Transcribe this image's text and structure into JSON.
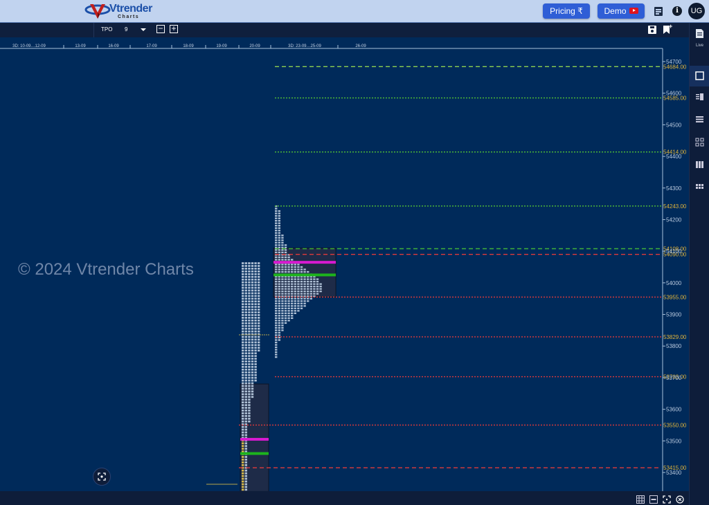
{
  "header": {
    "logo_brand": "Vtrender",
    "logo_sub": "Charts",
    "pricing_label": "Pricing ₹",
    "demo_label": "Demo",
    "avatar_initials": "UG",
    "icons": [
      "notes-icon",
      "info-icon"
    ]
  },
  "toolbar": {
    "tpo_label": "TPO",
    "tpo_value": "9",
    "minus_label": "−",
    "plus_label": "+",
    "icons": [
      "save-icon",
      "bookmark-add-icon"
    ]
  },
  "right_sidebar": {
    "live_label": "Live",
    "items": [
      "single-layout-icon",
      "split-layout-icon",
      "rows-layout-icon",
      "grid-2x2-icon",
      "columns-layout-icon",
      "grid-3x3-icon"
    ]
  },
  "bottom_bar": {
    "icons": [
      "grid-toggle-icon",
      "letters-toggle-icon",
      "fit-screen-icon",
      "close-circle-icon"
    ]
  },
  "watermark": "© 2024 Vtrender Charts",
  "chart_data": {
    "type": "tpo-market-profile",
    "x_labels": [
      "3D: 10-09…12-09",
      "13-09",
      "16-09",
      "17-09",
      "18-09",
      "19-09",
      "20-09",
      "3D: 23-09…25-09",
      "26-09"
    ],
    "y_ticks": [
      53400,
      53500,
      53600,
      53700,
      53800,
      53900,
      54000,
      54100,
      54200,
      54300,
      54400,
      54500,
      54600,
      54700
    ],
    "ylim": [
      53340,
      54730
    ],
    "levels": [
      {
        "price": 54684.0,
        "label": "54684.00",
        "color": "#8fd14f",
        "style": "dashed"
      },
      {
        "price": 54585.0,
        "label": "54585.00",
        "color": "#52c234",
        "style": "dotted"
      },
      {
        "price": 54414.0,
        "label": "54414.00",
        "color": "#52c234",
        "style": "dotted"
      },
      {
        "price": 54243.0,
        "label": "54243.00",
        "color": "#52c234",
        "style": "dotted"
      },
      {
        "price": 54108.0,
        "label": "54108.00",
        "color": "#3fb03a",
        "style": "dashed"
      },
      {
        "price": 54090.0,
        "label": "54090.00",
        "color": "#e03a3a",
        "style": "dashed"
      },
      {
        "price": 53955.0,
        "label": "53955.00",
        "color": "#e03a3a",
        "style": "dotted"
      },
      {
        "price": 53829.0,
        "label": "53829.00",
        "color": "#e03a3a",
        "style": "dotted"
      },
      {
        "price": 53703.0,
        "label": "53703.00",
        "color": "#e03a3a",
        "style": "dotted"
      },
      {
        "price": 53550.0,
        "label": "53550.00",
        "color": "#e03a3a",
        "style": "dotted"
      },
      {
        "price": 53415.0,
        "label": "53415.00",
        "color": "#e03a3a",
        "style": "dashed"
      }
    ],
    "profiles": [
      {
        "session": "20-09",
        "high": 54065,
        "low": 53340,
        "value_area_high": 53680,
        "value_area_low": 53340,
        "poc": 53505,
        "vwap": 53460,
        "widths": [
          6,
          6,
          6,
          6,
          6,
          6,
          6,
          6,
          6,
          6,
          6,
          6,
          6,
          6,
          6,
          6,
          6,
          6,
          6,
          6,
          6,
          6,
          6,
          6,
          6,
          6,
          6,
          6,
          6,
          6,
          6,
          6,
          6,
          5,
          5,
          5,
          5,
          5,
          5,
          5,
          5,
          5,
          5,
          5,
          4,
          4,
          4,
          4,
          4,
          4,
          3,
          3,
          3,
          3,
          3,
          3,
          3,
          3,
          3,
          2,
          2,
          2,
          2,
          2,
          2,
          2,
          2,
          2,
          2,
          2,
          2,
          2,
          2,
          2,
          2,
          2,
          2,
          2,
          2,
          2,
          2,
          2,
          2,
          2
        ]
      },
      {
        "session": "3D: 23-09…25-09",
        "high": 54245,
        "low": 53760,
        "value_area_high": 54110,
        "value_area_low": 53955,
        "poc": 54065,
        "vwap": 54025,
        "widths": [
          1,
          1,
          2,
          2,
          2,
          2,
          2,
          2,
          2,
          2,
          2,
          2,
          3,
          3,
          3,
          3,
          4,
          4,
          4,
          4,
          5,
          5,
          6,
          7,
          8,
          9,
          10,
          11,
          12,
          13,
          14,
          14,
          15,
          15,
          15,
          15,
          14,
          13,
          12,
          11,
          10,
          10,
          9,
          8,
          7,
          6,
          6,
          5,
          4,
          3,
          3,
          3,
          2,
          2,
          2,
          2,
          1,
          1,
          1,
          1,
          1,
          1,
          1
        ]
      }
    ],
    "tpo_letters": "ABCDEFGHIJKLM"
  }
}
